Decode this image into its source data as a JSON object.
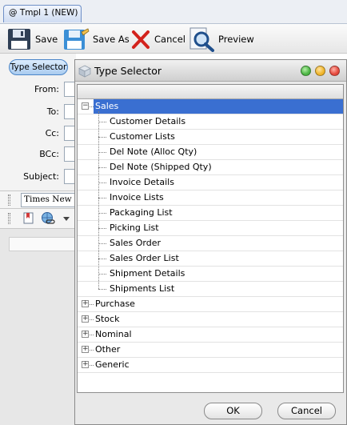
{
  "tab": {
    "label": "@ Tmpl 1 (NEW)"
  },
  "toolbar": {
    "save": {
      "label": "Save",
      "icon": "floppy-disk-icon"
    },
    "save_as": {
      "label": "Save As",
      "icon": "floppy-disk-pencil-icon"
    },
    "cancel": {
      "label": "Cancel",
      "icon": "red-x-icon"
    },
    "preview": {
      "label": "Preview",
      "icon": "magnifier-document-icon"
    }
  },
  "form": {
    "type_selector_button": "Type Selector",
    "labels": {
      "from": "From:",
      "to": "To:",
      "cc": "Cc:",
      "bcc": "BCc:",
      "subject": "Subject:"
    },
    "font_name": "Times New Roman"
  },
  "dialog": {
    "title": "Type Selector",
    "tree": [
      {
        "label": "Sales",
        "expanded": true,
        "selected": true,
        "children": [
          "Customer Details",
          "Customer Lists",
          "Del Note (Alloc Qty)",
          "Del Note (Shipped Qty)",
          "Invoice Details",
          "Invoice Lists",
          "Packaging List",
          "Picking List",
          "Sales Order",
          "Sales Order List",
          "Shipment Details",
          "Shipments List"
        ]
      },
      {
        "label": "Purchase",
        "expanded": false
      },
      {
        "label": "Stock",
        "expanded": false
      },
      {
        "label": "Nominal",
        "expanded": false
      },
      {
        "label": "Other",
        "expanded": false
      },
      {
        "label": "Generic",
        "expanded": false
      }
    ],
    "ok_button": "OK",
    "cancel_button": "Cancel"
  },
  "colors": {
    "selection": "#3a6fd1",
    "close": "#e5483c",
    "minimize": "#f0b429",
    "maximize": "#4bb543"
  }
}
